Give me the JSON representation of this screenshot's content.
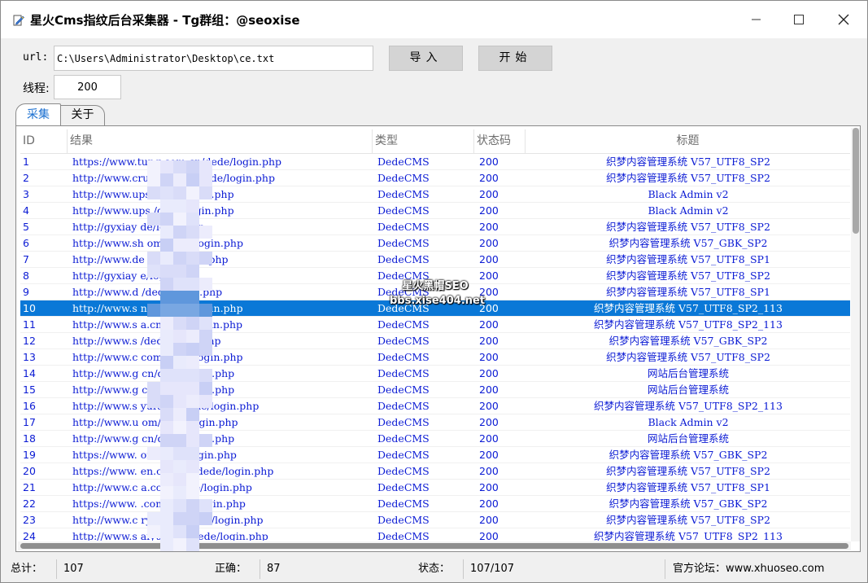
{
  "window": {
    "title": "星火Cms指纹后台采集器 - Tg群组：@seoxise"
  },
  "form": {
    "url_label": "url:",
    "url_value": "C:\\Users\\Administrator\\Desktop\\ce.txt",
    "import_label": "导入",
    "start_label": "开始",
    "thread_label": "线程:",
    "thread_value": "200"
  },
  "tabs": [
    "采集",
    "关于"
  ],
  "table": {
    "columns": [
      "ID",
      "结果",
      "类型",
      "状态码",
      "标题"
    ],
    "selected_row": 10,
    "rows": [
      {
        "id": "1",
        "url": "https://www.tung      com.cn/dede/login.php",
        "type": "DedeCMS",
        "code": "200",
        "title": "织梦内容管理系统 V57_UTF8_SP2"
      },
      {
        "id": "2",
        "url": "http://www.crus      com.cn/dede/login.php",
        "type": "DedeCMS",
        "code": "200",
        "title": "织梦内容管理系统 V57_UTF8_SP2"
      },
      {
        "id": "3",
        "url": "http://www.ups      /dede/login.php",
        "type": "DedeCMS",
        "code": "200",
        "title": "Black Admin v2"
      },
      {
        "id": "4",
        "url": "http://www.ups      /dede/login.php",
        "type": "DedeCMS",
        "code": "200",
        "title": "Black Admin v2"
      },
      {
        "id": "5",
        "url": "http://gyxiay      de/login.php",
        "type": "DedeCMS",
        "code": "200",
        "title": "织梦内容管理系统 V57_UTF8_SP2"
      },
      {
        "id": "6",
        "url": "http://www.sh      om/dede/login.php",
        "type": "DedeCMS",
        "code": "200",
        "title": "织梦内容管理系统 V57_GBK_SP2"
      },
      {
        "id": "7",
        "url": "http://www.de      /dede/login.php",
        "type": "DedeCMS",
        "code": "200",
        "title": "织梦内容管理系统 V57_UTF8_SP1"
      },
      {
        "id": "8",
        "url": "http://gyxiay      e/login.php",
        "type": "DedeCMS",
        "code": "200",
        "title": "织梦内容管理系统 V57_UTF8_SP2"
      },
      {
        "id": "9",
        "url": "http://www.d      /dede/login.php",
        "type": "DedeCMS",
        "code": "200",
        "title": "织梦内容管理系统 V57_UTF8_SP1"
      },
      {
        "id": "10",
        "url": "http://www.s      n.cn/dede/login.php",
        "type": "DedeCMS",
        "code": "200",
        "title": "织梦内容管理系统 V57_UTF8_SP2_113"
      },
      {
        "id": "11",
        "url": "http://www.s      a.cn/dede/login.php",
        "type": "DedeCMS",
        "code": "200",
        "title": "织梦内容管理系统 V57_UTF8_SP2_113"
      },
      {
        "id": "12",
        "url": "http://www.s      /dede/login.php",
        "type": "DedeCMS",
        "code": "200",
        "title": "织梦内容管理系统 V57_GBK_SP2"
      },
      {
        "id": "13",
        "url": "http://www.c      com/dede/login.php",
        "type": "DedeCMS",
        "code": "200",
        "title": "织梦内容管理系统 V57_UTF8_SP2"
      },
      {
        "id": "14",
        "url": "http://www.g      cn/dede/login.php",
        "type": "DedeCMS",
        "code": "200",
        "title": "网站后台管理系统"
      },
      {
        "id": "15",
        "url": "http://www.g      cn/dede/login.php",
        "type": "DedeCMS",
        "code": "200",
        "title": "网站后台管理系统"
      },
      {
        "id": "16",
        "url": "http://www.s      yufu.cn/dede/login.php",
        "type": "DedeCMS",
        "code": "200",
        "title": "织梦内容管理系统 V57_UTF8_SP2_113"
      },
      {
        "id": "17",
        "url": "http://www.u      om/dede/login.php",
        "type": "DedeCMS",
        "code": "200",
        "title": "Black Admin v2"
      },
      {
        "id": "18",
        "url": "http://www.g      cn/dede/login.php",
        "type": "DedeCMS",
        "code": "200",
        "title": "网站后台管理系统"
      },
      {
        "id": "19",
        "url": "https://www.      om/dede/login.php",
        "type": "DedeCMS",
        "code": "200",
        "title": "织梦内容管理系统 V57_GBK_SP2"
      },
      {
        "id": "20",
        "url": "https://www.      en.com.cn/dede/login.php",
        "type": "DedeCMS",
        "code": "200",
        "title": "织梦内容管理系统 V57_UTF8_SP2"
      },
      {
        "id": "21",
        "url": "http://www.c      a.com/dede/login.php",
        "type": "DedeCMS",
        "code": "200",
        "title": "织梦内容管理系统 V57_UTF8_SP1"
      },
      {
        "id": "22",
        "url": "https://www.      .com/dede/login.php",
        "type": "DedeCMS",
        "code": "200",
        "title": "织梦内容管理系统 V57_GBK_SP2"
      },
      {
        "id": "23",
        "url": "http://www.c      ryh.com/dede/login.php",
        "type": "DedeCMS",
        "code": "200",
        "title": "织梦内容管理系统 V57_UTF8_SP2"
      },
      {
        "id": "24",
        "url": "http://www.s      aiyufu.cn/dede/login.php",
        "type": "DedeCMS",
        "code": "200",
        "title": "织梦内容管理系统 V57_UTF8_SP2_113"
      }
    ]
  },
  "watermark": {
    "line1": "星火黑帽SEO",
    "line2": "bbs.xise404.net"
  },
  "status": {
    "total_label": "总计：",
    "total_value": "107",
    "correct_label": "正确：",
    "correct_value": "87",
    "state_label": "状态：",
    "state_value": "107/107",
    "forum": "官方论坛：www.xhuoseo.com"
  },
  "colors": {
    "selection": "#0a78d7",
    "row_text": "#0b1bd4",
    "tab_active_text": "#1a6fd0"
  }
}
